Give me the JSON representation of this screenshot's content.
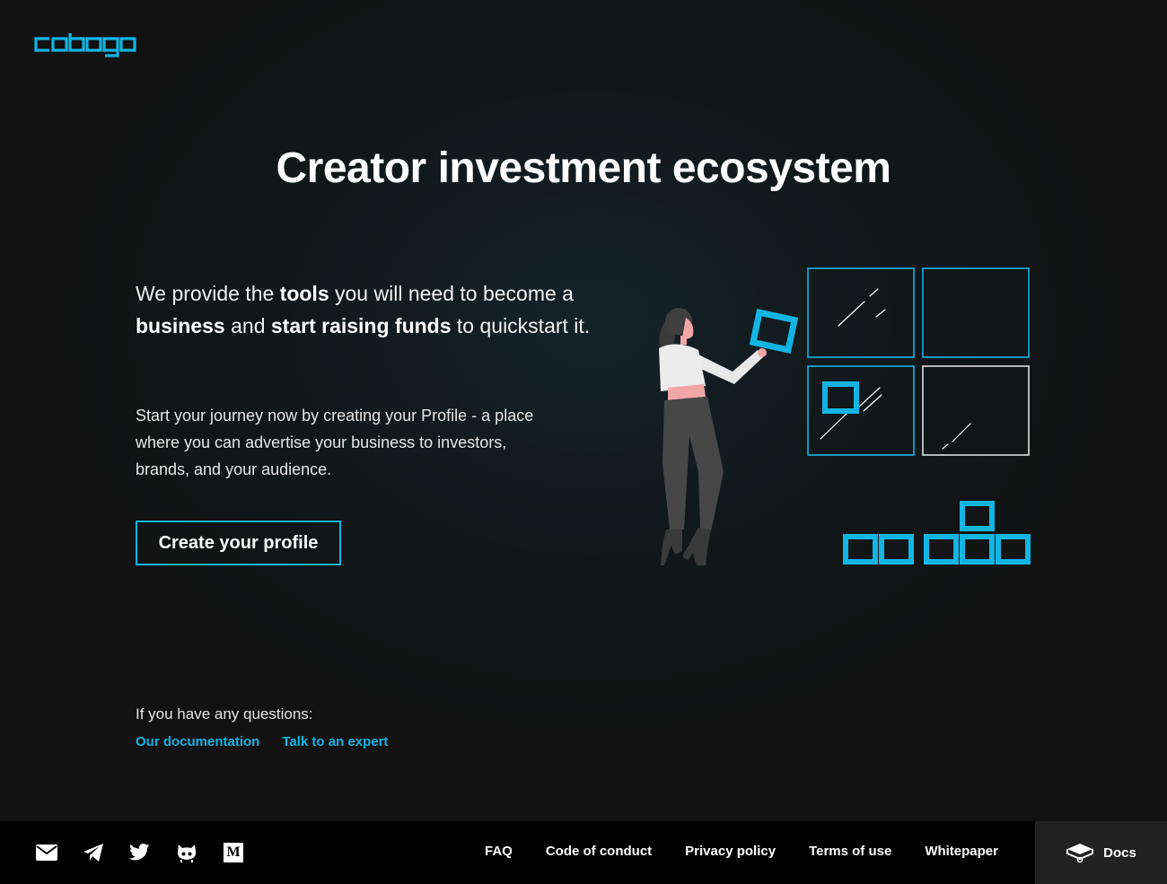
{
  "brand": {
    "logo_text": "cobogo",
    "accent": "#11b5e4"
  },
  "hero": {
    "title": "Creator investment ecosystem",
    "lead": {
      "part1": "We provide the ",
      "bold1": "tools",
      "part2": " you will need to become a ",
      "bold2": "business",
      "part3": " and ",
      "bold3": "start raising funds",
      "part4": " to quickstart it."
    },
    "description": "Start your journey now by creating your Profile - a place where you can advertise your business to investors, brands, and your audience.",
    "cta_label": "Create your profile"
  },
  "help": {
    "prompt": "If you have any questions:",
    "links": [
      "Our documentation",
      "Talk to an expert"
    ]
  },
  "footer": {
    "social_icons": [
      "mail-icon",
      "telegram-icon",
      "twitter-icon",
      "github-icon",
      "medium-icon"
    ],
    "medium_letter": "M",
    "nav": [
      "FAQ",
      "Code of conduct",
      "Privacy policy",
      "Terms of use",
      "Whitepaper"
    ],
    "docs_label": "Docs"
  }
}
